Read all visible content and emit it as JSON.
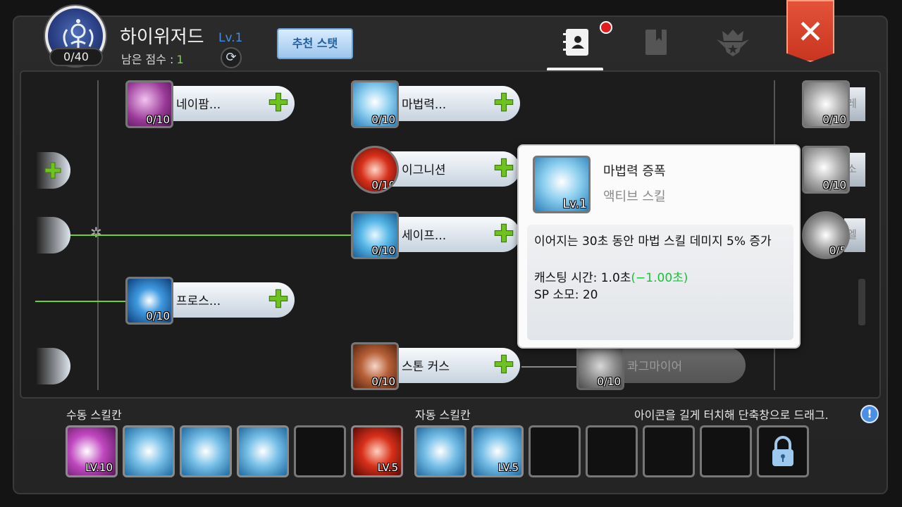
{
  "header": {
    "job_title": "하이위저드",
    "job_level": "Lv.1",
    "points": "0/40",
    "remain_label": "남은 점수 :",
    "remain_value": "1",
    "recommend_button": "추천 스탯"
  },
  "tabs": [
    {
      "name": "skill-book-tab",
      "icon": "contacts-book-icon",
      "active": true,
      "notification": true
    },
    {
      "name": "book-tab",
      "icon": "bookmark-book-icon",
      "active": false
    },
    {
      "name": "emblem-tab",
      "icon": "crown-shield-icon",
      "active": false
    }
  ],
  "skills": {
    "napalm": {
      "label": "네이팜...",
      "level": "0/10"
    },
    "magic_power": {
      "label": "마법력...",
      "level": "0/10"
    },
    "ignition": {
      "label": "이그니션",
      "level": "0/10"
    },
    "safety": {
      "label": "세이프...",
      "level": "0/10"
    },
    "frost": {
      "label": "프로스...",
      "level": "0/10"
    },
    "stone_curse": {
      "label": "스톤 커스",
      "level": "0/10"
    },
    "quagmire": {
      "label": "콰그마이어",
      "level": "0/10"
    },
    "right_1": {
      "label": "레",
      "level": "0/10"
    },
    "right_2": {
      "label": "소",
      "level": "0/10"
    },
    "right_3": {
      "label": "엘",
      "level": "0/5"
    }
  },
  "tooltip": {
    "name": "마법력 증폭",
    "type": "액티브 스킬",
    "level": "Lv.1",
    "description": "이어지는 30초 동안 마법 스킬 데미지 5% 증가",
    "cast_label": "캐스팅 시간: 1.0초",
    "cast_bonus": "(−1.00초)",
    "sp_label": "SP 소모: 20"
  },
  "bottom": {
    "manual_label": "수동 스킬칸",
    "auto_label": "자동 스킬칸",
    "hint": "아이콘을 길게 터치해 단축창으로 드래그.",
    "slot_levels": {
      "manual_1": "LV.10",
      "manual_6": "LV.5",
      "auto_2": "LV.5"
    }
  }
}
